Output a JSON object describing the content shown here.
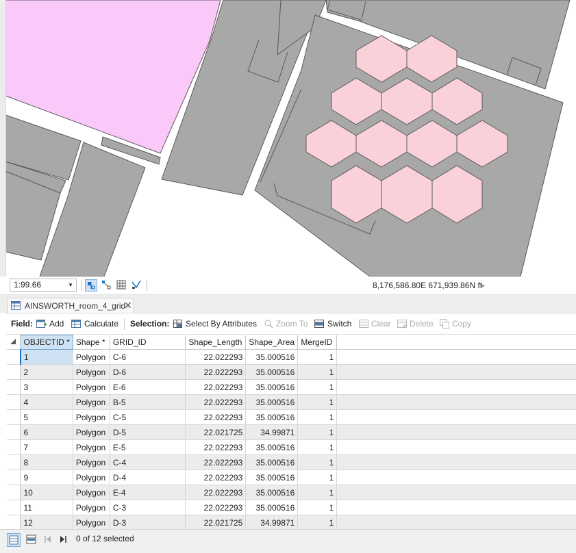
{
  "map": {
    "colors": {
      "background": "#ffffff",
      "building": "#a8a8a8",
      "outline": "#595959",
      "room_highlight": "#fac9fa",
      "hexagon": "#fad1d8",
      "hex_outline": "#5a5a5a"
    }
  },
  "statusbar": {
    "scale": "1:99.66",
    "coordinates": "8,176,586.80E 671,939.86N ft",
    "icons": [
      "navigate-icon",
      "snapping-icon",
      "grid-icon",
      "labels-icon"
    ]
  },
  "tab": {
    "label": "AINSWORTH_room_4_grid",
    "close": "✕"
  },
  "toolbar": {
    "field_label": "Field:",
    "add": "Add",
    "calculate": "Calculate",
    "selection_label": "Selection:",
    "select_by_attributes": "Select By Attributes",
    "zoom_to": "Zoom To",
    "switch": "Switch",
    "clear": "Clear",
    "delete": "Delete",
    "copy": "Copy"
  },
  "table": {
    "columns": [
      "OBJECTID *",
      "Shape *",
      "GRID_ID",
      "Shape_Length",
      "Shape_Area",
      "MergeID"
    ],
    "rows": [
      [
        "1",
        "Polygon",
        "C-6",
        "22.022293",
        "35.000516",
        "1"
      ],
      [
        "2",
        "Polygon",
        "D-6",
        "22.022293",
        "35.000516",
        "1"
      ],
      [
        "3",
        "Polygon",
        "E-6",
        "22.022293",
        "35.000516",
        "1"
      ],
      [
        "4",
        "Polygon",
        "B-5",
        "22.022293",
        "35.000516",
        "1"
      ],
      [
        "5",
        "Polygon",
        "C-5",
        "22.022293",
        "35.000516",
        "1"
      ],
      [
        "6",
        "Polygon",
        "D-5",
        "22.021725",
        "34.99871",
        "1"
      ],
      [
        "7",
        "Polygon",
        "E-5",
        "22.022293",
        "35.000516",
        "1"
      ],
      [
        "8",
        "Polygon",
        "C-4",
        "22.022293",
        "35.000516",
        "1"
      ],
      [
        "9",
        "Polygon",
        "D-4",
        "22.022293",
        "35.000516",
        "1"
      ],
      [
        "10",
        "Polygon",
        "E-4",
        "22.022293",
        "35.000516",
        "1"
      ],
      [
        "11",
        "Polygon",
        "C-3",
        "22.022293",
        "35.000516",
        "1"
      ],
      [
        "12",
        "Polygon",
        "D-3",
        "22.021725",
        "34.99871",
        "1"
      ]
    ]
  },
  "footer": {
    "selection_status": "0 of 12 selected"
  }
}
